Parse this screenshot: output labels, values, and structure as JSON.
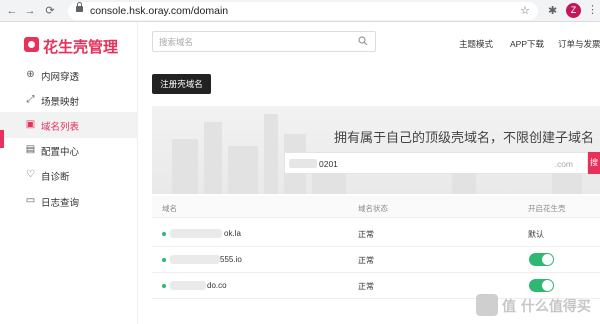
{
  "browser": {
    "url": "console.hsk.oray.com/domain",
    "back_icon": "←",
    "forward_icon": "→",
    "reload_icon": "⟳",
    "star_icon": "☆",
    "extensions_icon": "✱",
    "profile_initial": "Z",
    "menu_icon": "⋮"
  },
  "app": {
    "logo_text": "花生壳管理",
    "brand_color": "#e8305b"
  },
  "sidebar": {
    "items": [
      {
        "label": "内网穿透",
        "icon": "⊕"
      },
      {
        "label": "场景映射",
        "icon": "⤢"
      },
      {
        "label": "域名列表",
        "icon": "▣"
      },
      {
        "label": "配置中心",
        "icon": "▤"
      },
      {
        "label": "自诊断",
        "icon": "♡"
      },
      {
        "label": "日志查询",
        "icon": "▭"
      }
    ],
    "active_label": "域名列表"
  },
  "header": {
    "search_placeholder": "搜索域名",
    "links": [
      "主题模式",
      "APP下载",
      "订单与发票"
    ]
  },
  "main": {
    "register_button": "注册壳域名",
    "banner_title": "拥有属于自己的顶级壳域名，不限创建子域名",
    "domain_input_value": "0201",
    "domain_suffix": ".com",
    "domain_button": "搜"
  },
  "table": {
    "columns": [
      "域名",
      "域名状态",
      "开启花生壳"
    ],
    "rows": [
      {
        "domain": "ok.la",
        "status": "正常",
        "action": "默认",
        "toggle_on": false
      },
      {
        "domain": "555.io",
        "status": "正常",
        "action": "",
        "toggle_on": true
      },
      {
        "domain": "do.co",
        "status": "正常",
        "action": "",
        "toggle_on": true
      }
    ],
    "status_color": "#2eb872"
  },
  "watermark": {
    "text": "值 什么值得买"
  }
}
